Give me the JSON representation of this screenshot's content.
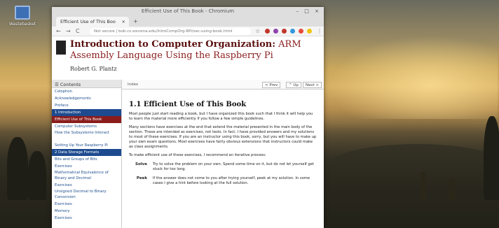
{
  "desktop": {
    "icon_label": "Wastebasket"
  },
  "window": {
    "title": "Efficient Use of This Book - Chromium",
    "controls": "– □ ×"
  },
  "tab": {
    "label": "Efficient Use of This Boo",
    "close": "×",
    "new": "+"
  },
  "toolbar": {
    "back": "←",
    "forward": "→",
    "reload": "C",
    "url": "Not secure | bob.cs.sonoma.edu/IntroCompOrg-RPi/sec-using-book.html",
    "star": "☆"
  },
  "book": {
    "title_bold": "Introduction to Computer Organization:",
    "title_rest": " ARM Assembly Language Using the Raspberry Pi",
    "author": "Robert G. Plantz"
  },
  "sidebar": {
    "header": "☰ Contents",
    "items": [
      {
        "label": "Colophon",
        "kind": "link"
      },
      {
        "label": "Acknowledgements",
        "kind": "link"
      },
      {
        "label": "Preface",
        "kind": "link"
      },
      {
        "label": "1  Introduction",
        "kind": "chapter"
      },
      {
        "label": "Efficient Use of This Book",
        "kind": "active"
      },
      {
        "label": "Computer Subsystems",
        "kind": "link"
      },
      {
        "label": "How the Subsystems Interact",
        "kind": "two"
      },
      {
        "label": "Setting Up Your Raspberry Pi",
        "kind": "link"
      },
      {
        "label": "2  Data Storage Formats",
        "kind": "chapter"
      },
      {
        "label": "Bits and Groups of Bits",
        "kind": "link"
      },
      {
        "label": "Exercises",
        "kind": "link"
      },
      {
        "label": "Mathematical Equivalence of Binary and Decimal",
        "kind": "two"
      },
      {
        "label": "Exercises",
        "kind": "link"
      },
      {
        "label": "Unsigned Decimal to Binary Conversion",
        "kind": "two"
      },
      {
        "label": "Exercises",
        "kind": "link"
      },
      {
        "label": "Memory",
        "kind": "link"
      },
      {
        "label": "Exercises",
        "kind": "link"
      }
    ]
  },
  "topnav": {
    "index": "Index",
    "prev": "< Prev",
    "up": "^ Up",
    "next": "Next >"
  },
  "content": {
    "heading": "1.1 Efficient Use of This Book",
    "p1": "Most people just start reading a book, but I have organized this book such that I think it will help you to learn the material more efficiently if you follow a few simple guidelines.",
    "p2": "Many sections have exercises at the end that extend the material presented in the main body of the section. These are intended as exercises, not tests. In fact, I have provided answers and my solutions to most of these exercises. If you are an instructor using this book, sorry, but you will have to make up your own exam questions. Most exercises have fairly obvious extensions that instructors could make as class assignments.",
    "p3": "To make efficient use of these exercises, I recommend an iterative process:",
    "steps": [
      {
        "term": "Solve",
        "desc": "Try to solve the problem on your own. Spend some time on it, but do not let yourself get stuck for too long."
      },
      {
        "term": "Peek",
        "desc": "If the answer does not come to you after trying yourself, peek at my solution. In some cases I give a hint before looking at the full solution."
      }
    ]
  }
}
